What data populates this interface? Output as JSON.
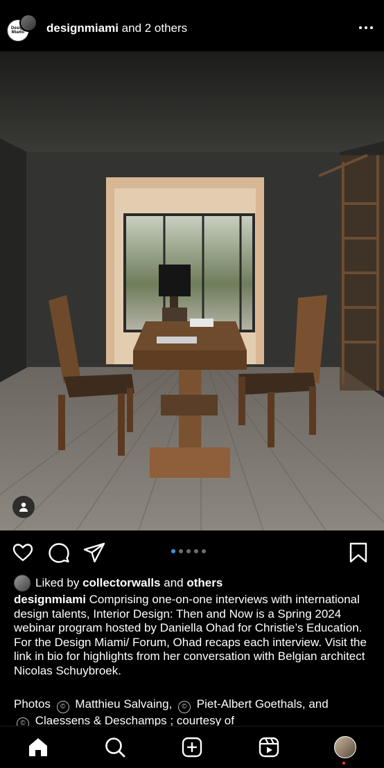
{
  "header": {
    "username": "designmiami",
    "others_text": "and 2 others",
    "avatar_text": "Design Miami/"
  },
  "carousel": {
    "slide_count": 5,
    "active_index": 0
  },
  "likes": {
    "prefix": "Liked by",
    "user": "collectorwalls",
    "joiner": "and",
    "others": "others"
  },
  "caption": {
    "username": "designmiami",
    "text": "Comprising one-on-one interviews with international design talents, Interior Design: Then and Now is a Spring 2024 webinar program hosted by Daniella Ohad for Christie’s Education. For the Design Miami/ Forum, Ohad recaps each interview. Visit the link in bio for highlights from her conversation with Belgian architect Nicolas Schuybroek."
  },
  "credits": {
    "label": "Photos",
    "copyright_symbol": "©",
    "credit_1": "Matthieu Salvaing,",
    "credit_2": "Piet-Albert Goethals, and",
    "credit_3": "Claessens & Deschamps ; courtesy of"
  },
  "colors": {
    "accent_dot": "#3897f0",
    "notification": "#ff3040"
  },
  "icons": [
    "more-icon",
    "tag-people-icon",
    "heart-icon",
    "comment-icon",
    "share-icon",
    "bookmark-icon",
    "home-icon",
    "search-icon",
    "create-icon",
    "reels-icon"
  ]
}
